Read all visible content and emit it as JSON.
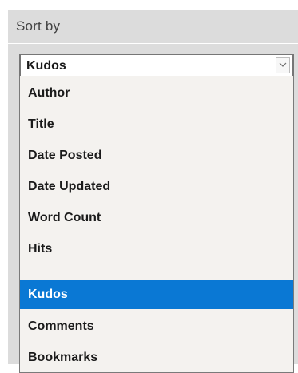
{
  "sort": {
    "label": "Sort by",
    "selected_value": "Kudos",
    "arrow_icon": "chevron-down-icon",
    "highlight_color": "#0a78d4",
    "options": [
      {
        "label": "Author"
      },
      {
        "label": "Title"
      },
      {
        "label": "Date Posted"
      },
      {
        "label": "Date Updated"
      },
      {
        "label": "Word Count"
      },
      {
        "label": "Hits"
      },
      {
        "label": "Kudos",
        "selected": true
      },
      {
        "label": "Comments"
      },
      {
        "label": "Bookmarks"
      }
    ]
  }
}
